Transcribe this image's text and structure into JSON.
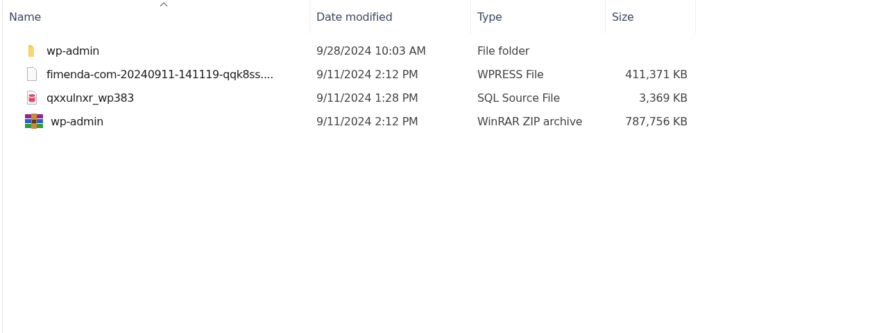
{
  "columns": [
    {
      "label": "Name",
      "sorted": true
    },
    {
      "label": "Date modified",
      "sorted": false
    },
    {
      "label": "Type",
      "sorted": false
    },
    {
      "label": "Size",
      "sorted": false
    }
  ],
  "rows": [
    {
      "kind": "folder",
      "name": "wp-admin",
      "date": "9/28/2024 10:03 AM",
      "type": "File folder"
    },
    {
      "kind": "file",
      "name": "fimenda-com-20240911-141119-qqk8ss....",
      "date": "9/11/2024 2:12 PM",
      "type": "WPRESS File",
      "size": "411,371 KB"
    },
    {
      "kind": "database",
      "name": "qxxulnxr_wp383",
      "date": "9/11/2024 1:28 PM",
      "type": "SQL Source File",
      "size": "3,369 KB"
    },
    {
      "kind": "archive",
      "name": "wp-admin",
      "date": "9/11/2024 2:12 PM",
      "type": "WinRAR ZIP archive",
      "size": "787,756 KB"
    }
  ]
}
